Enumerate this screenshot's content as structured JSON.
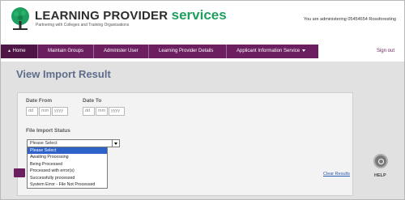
{
  "header": {
    "brand_main": "LEARNING PROVIDER ",
    "brand_accent": "services",
    "tagline": "Partnering with Colleges and Training Organisations",
    "admin_text": "You are administering 05454654 Rossforesting",
    "accent_color": "#1e9e5f"
  },
  "nav": {
    "items": [
      {
        "label": "Home",
        "icon": "home-icon"
      },
      {
        "label": "Maintain Groups"
      },
      {
        "label": "Administer User"
      },
      {
        "label": "Learning Provider Details"
      },
      {
        "label": "Applicant Information Service"
      }
    ],
    "signout_label": "Sign out",
    "bar_color": "#6b1f60"
  },
  "page": {
    "title": "View Import Result"
  },
  "filters": {
    "date_from_label": "Date From",
    "date_to_label": "Date To",
    "date_placeholders": {
      "dd": "dd",
      "mm": "mm",
      "yyyy": "yyyy"
    },
    "status_label": "File Import Status",
    "status_selected": "Please Select",
    "status_options": [
      "Please Select",
      "Awaiting Processing",
      "Being Processed",
      "Processed with error(s)",
      "Successfully processed",
      "System Error - File Not Processed"
    ]
  },
  "actions": {
    "clear_label": "Clear Results",
    "help_label": "HELP"
  }
}
